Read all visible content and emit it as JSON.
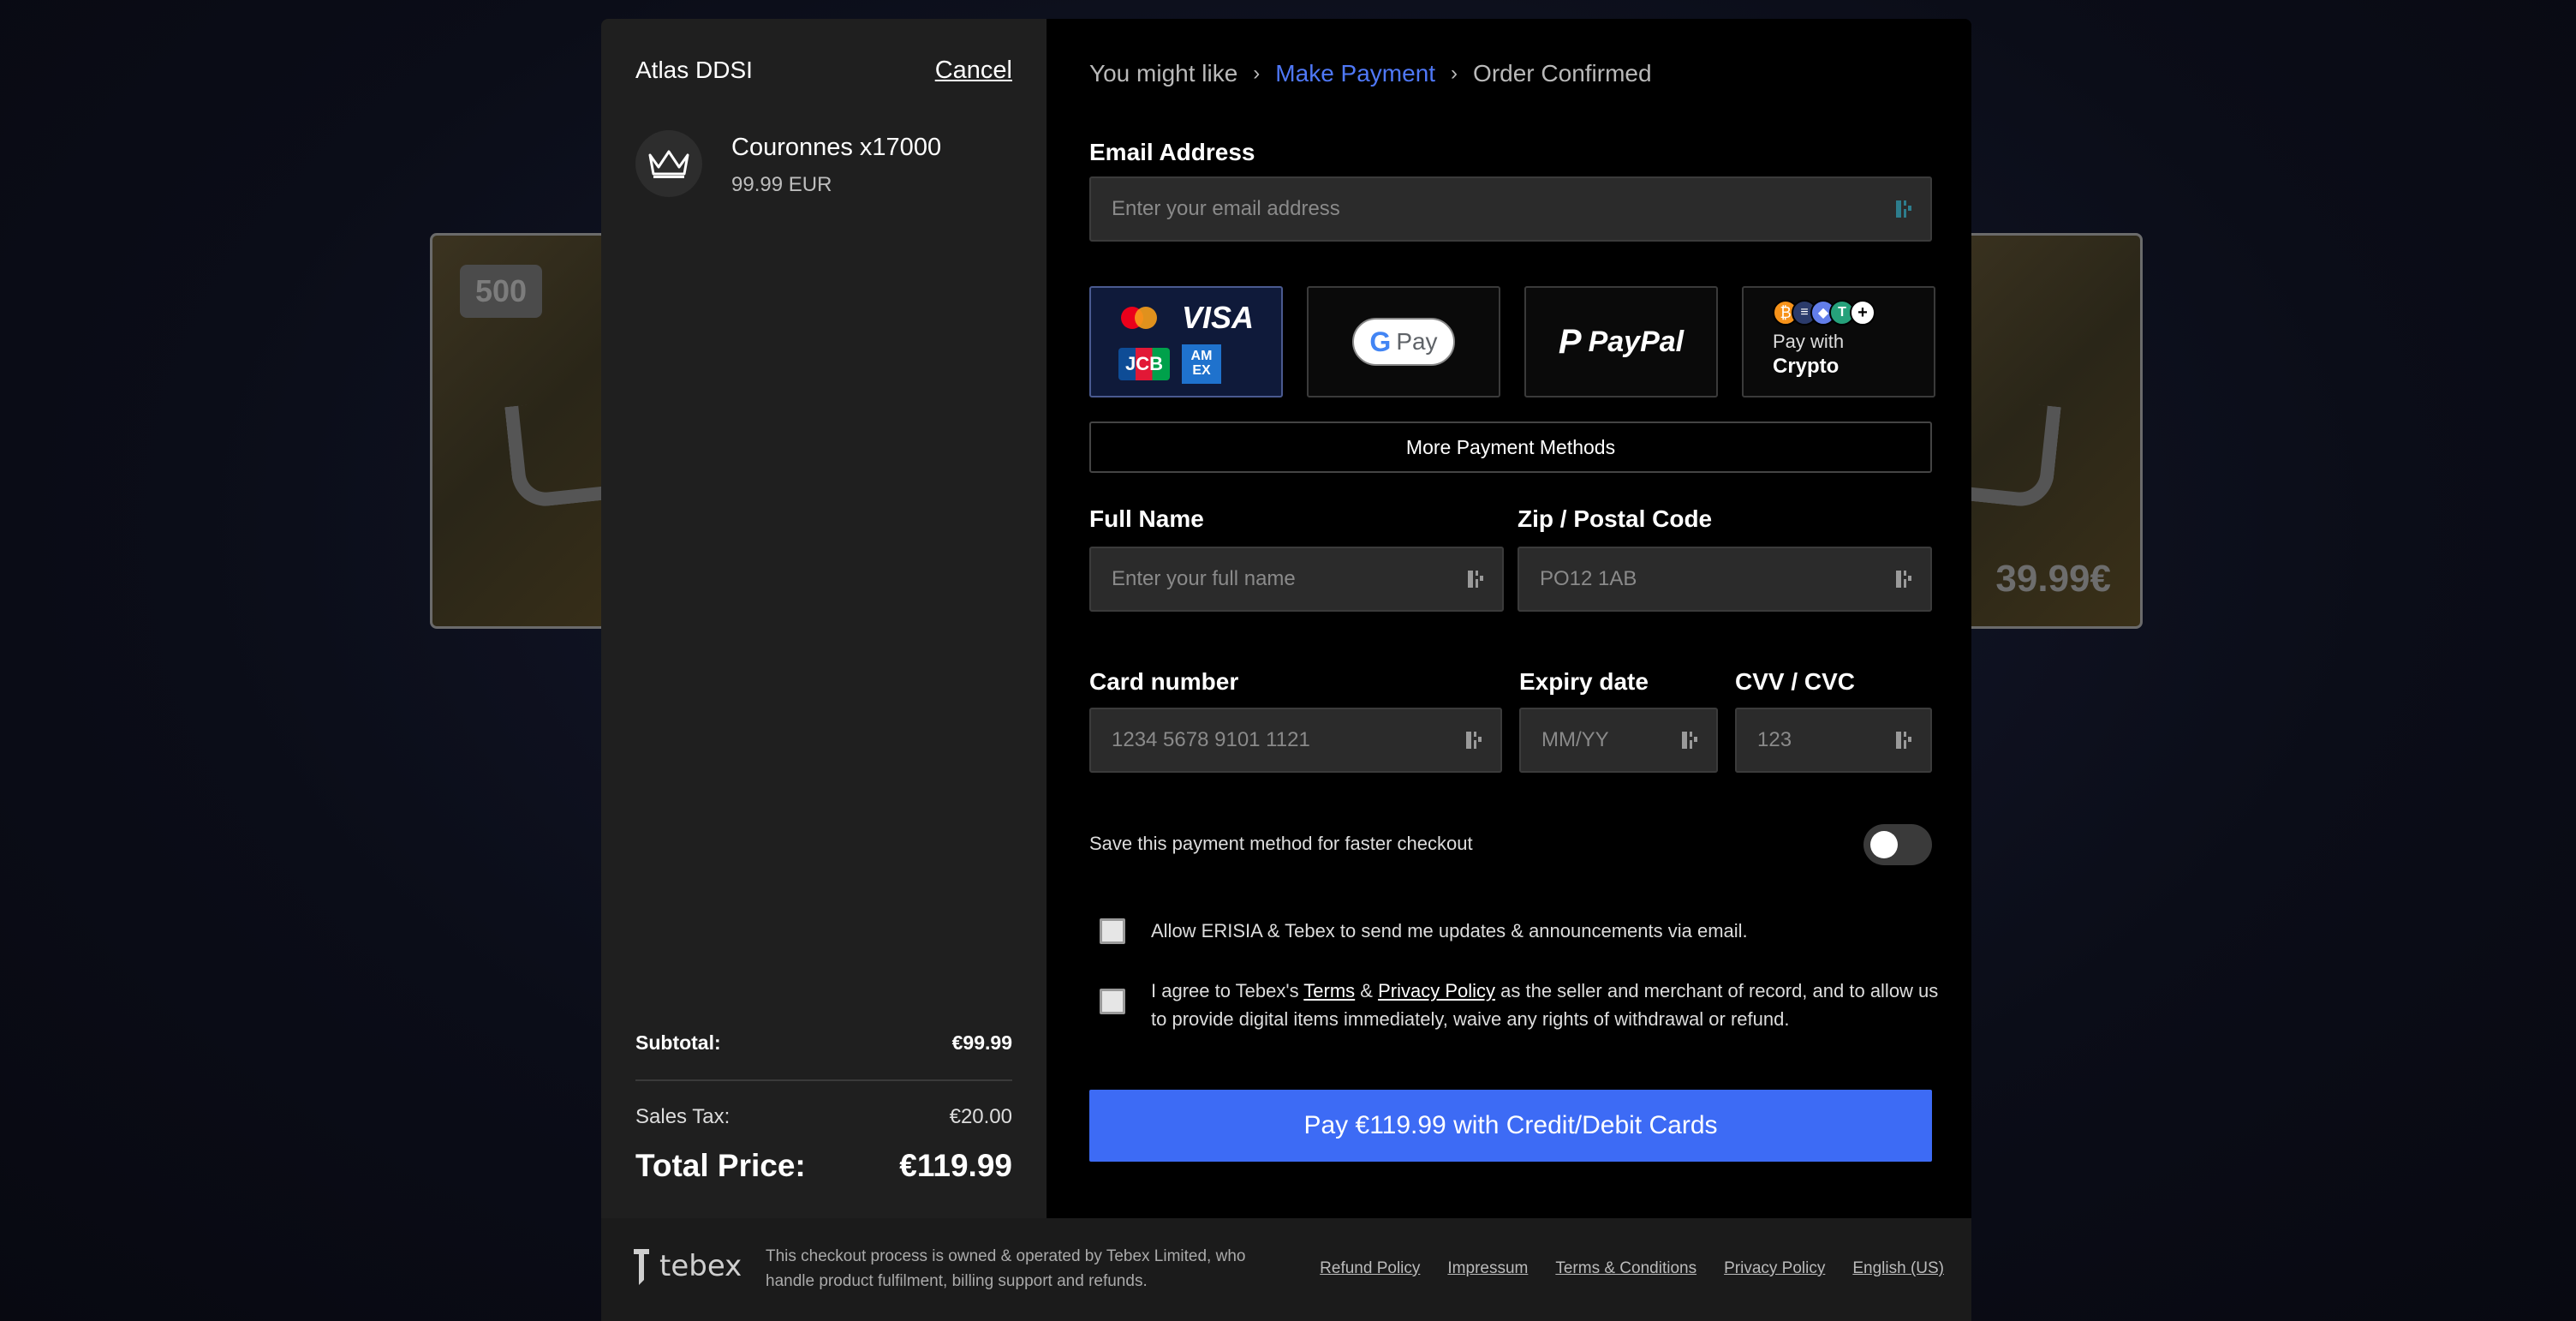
{
  "background": {
    "left_card_tag": "500",
    "right_card_price": "39.99€"
  },
  "order": {
    "store_name": "Atlas DDSI",
    "cancel_label": "Cancel",
    "product_name": "Couronnes x17000",
    "product_price": "99.99 EUR",
    "subtotal_label": "Subtotal:",
    "subtotal_value": "€99.99",
    "tax_label": "Sales Tax:",
    "tax_value": "€20.00",
    "total_label": "Total Price:",
    "total_value": "€119.99"
  },
  "breadcrumb": {
    "step1": "You might like",
    "step2": "Make Payment",
    "step3": "Order Confirmed"
  },
  "email": {
    "label": "Email Address",
    "placeholder": "Enter your email address"
  },
  "payment_methods": {
    "visa_text": "VISA",
    "jcb_text": "JCB",
    "amex_text": "AM EX",
    "gpay_text": "Pay",
    "paypal_text": "PayPal",
    "crypto_line1": "Pay with",
    "crypto_line2": "Crypto",
    "more_label": "More Payment Methods"
  },
  "form": {
    "full_name_label": "Full Name",
    "full_name_placeholder": "Enter your full name",
    "zip_label": "Zip / Postal Code",
    "zip_placeholder": "PO12 1AB",
    "card_label": "Card number",
    "card_placeholder": "1234 5678 9101 1121",
    "expiry_label": "Expiry date",
    "expiry_placeholder": "MM/YY",
    "cvv_label": "CVV / CVC",
    "cvv_placeholder": "123"
  },
  "options": {
    "save_label": "Save this payment method for faster checkout",
    "save_enabled": false,
    "consent_updates": "Allow ERISIA & Tebex to send me updates & announcements via email.",
    "agree_prefix": "I agree to Tebex's ",
    "agree_terms": "Terms",
    "agree_amp": " & ",
    "agree_privacy": "Privacy Policy",
    "agree_suffix": " as the seller and merchant of record, and to allow us to provide digital items immediately, waive any rights of withdrawal or refund."
  },
  "pay_button_label": "Pay €119.99 with Credit/Debit Cards",
  "footer": {
    "brand": "tebex",
    "note": "This checkout process is owned & operated by Tebex Limited, who handle product fulfilment, billing support and refunds.",
    "links": [
      "Refund Policy",
      "Impressum",
      "Terms & Conditions",
      "Privacy Policy",
      "English (US)"
    ]
  },
  "colors": {
    "accent": "#3d6bf5",
    "breadcrumb_active": "#4f78f7",
    "modal_left": "#1f1f1f",
    "modal_right": "#000000"
  }
}
